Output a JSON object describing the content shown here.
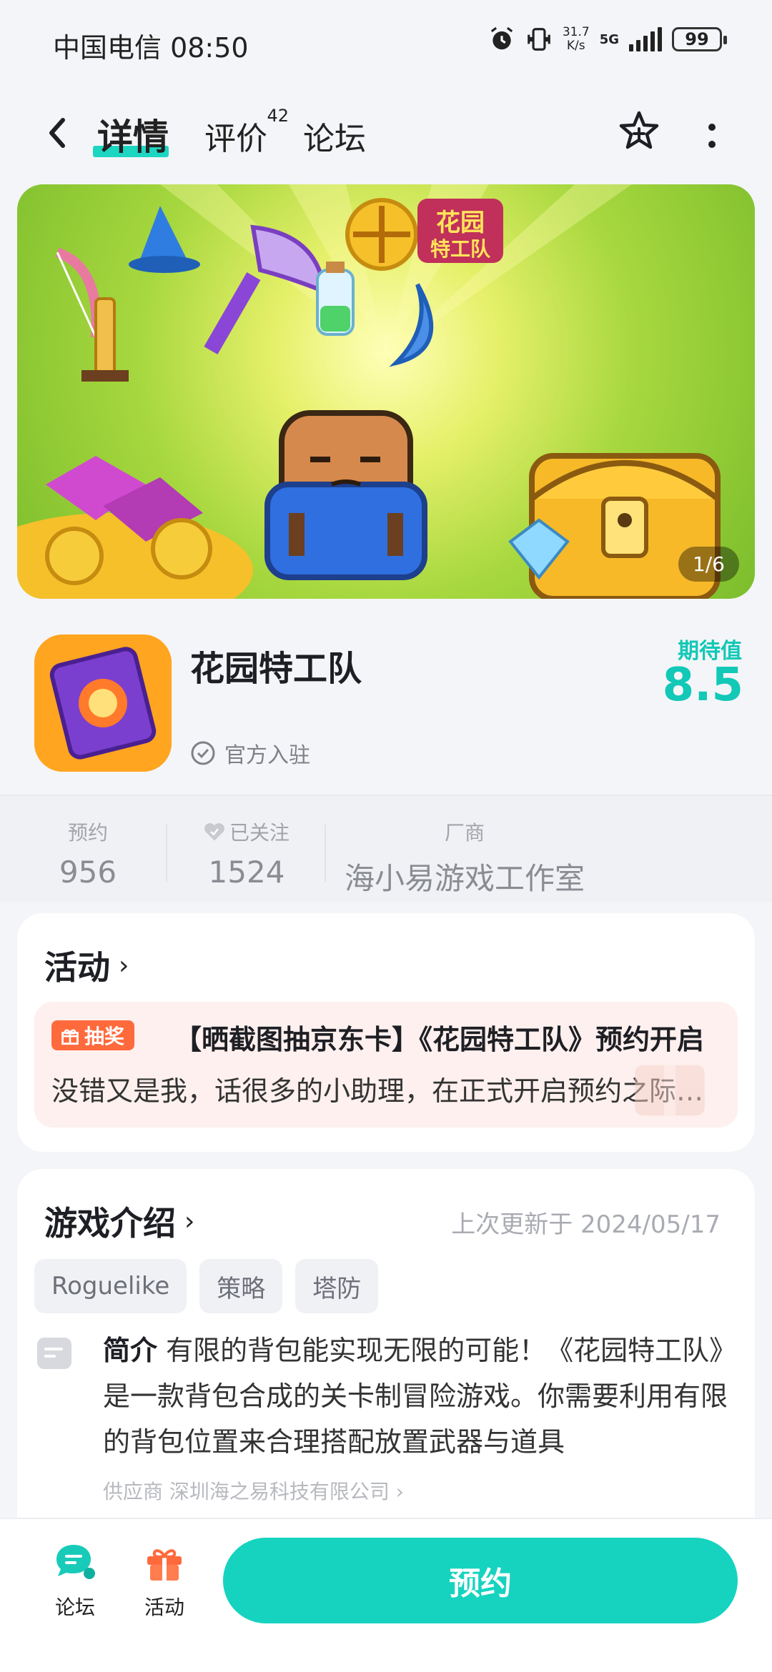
{
  "status_bar": {
    "carrier_time": "中国电信 08:50",
    "speed_top": "31.7",
    "speed_unit": "K/s",
    "network": "5G",
    "battery": "99"
  },
  "nav": {
    "tab_detail": "详情",
    "tab_review": "评价",
    "review_count": "42",
    "tab_forum": "论坛"
  },
  "banner": {
    "counter": "1/6",
    "game_logo_text": "花园特工队"
  },
  "app": {
    "name": "花园特工队",
    "official": "官方入驻",
    "expect_label": "期待值",
    "expect_value": "8.5"
  },
  "stats": {
    "reserve_label": "预约",
    "reserve_value": "956",
    "follow_label": "已关注",
    "follow_value": "1524",
    "vendor_label": "厂商",
    "vendor_value": "海小易游戏工作室"
  },
  "activity": {
    "title": "活动",
    "badge": "抽奖",
    "promo_title": "【晒截图抽京东卡】《花园特工队》预约开启",
    "promo_desc": "没错又是我，话很多的小助理，在正式开启预约之际来和大家说几句"
  },
  "intro": {
    "title": "游戏介绍",
    "updated": "上次更新于 2024/05/17",
    "tags": [
      "Roguelike",
      "策略",
      "塔防"
    ],
    "label": "简介",
    "text": "有限的背包能实现无限的可能！《花园特工队》是一款背包合成的关卡制冒险游戏。你需要利用有限的背包位置来合理搭配放置武器与道具",
    "supplier": "供应商 深圳海之易科技有限公司 ›"
  },
  "bottom": {
    "forum": "论坛",
    "activity": "活动",
    "reserve": "预约"
  },
  "colors": {
    "accent": "#16d3c0",
    "promo_badge": "#ff6a3d"
  }
}
